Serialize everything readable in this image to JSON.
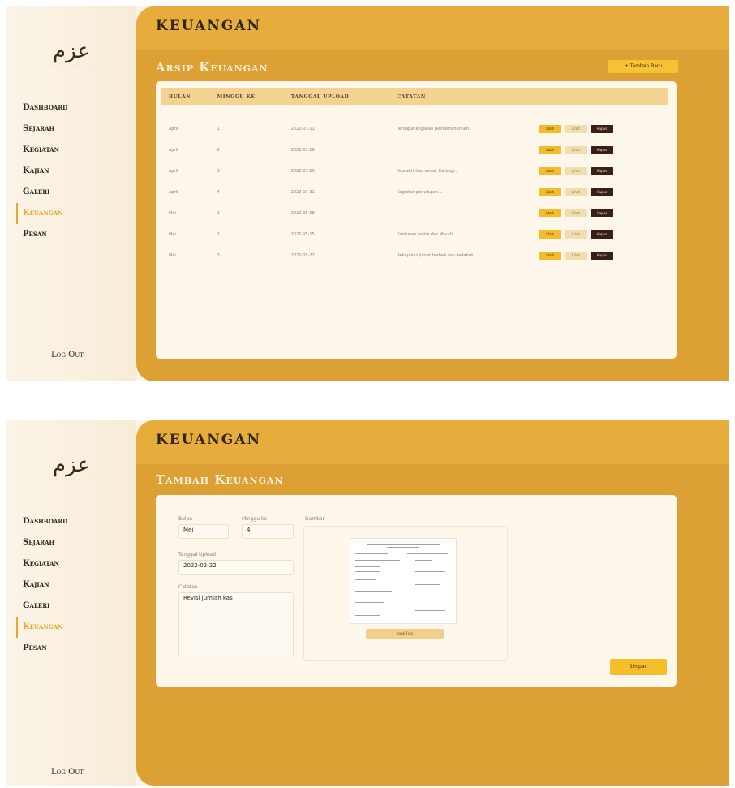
{
  "app": {
    "logo_text": "عزم",
    "nav": [
      "Dashboard",
      "Sejarah",
      "Kegiatan",
      "Kajian",
      "Galeri",
      "Keuangan",
      "Pesan"
    ],
    "active_nav": "Keuangan",
    "logout": "Log Out",
    "header_title": "KEUANGAN"
  },
  "archive": {
    "title": "Arsip Keuangan",
    "add_button": "+ Tambah Baru",
    "columns": [
      "BULAN",
      "MINGGU KE",
      "TANGGAL UPLOAD",
      "CATATAN"
    ],
    "rows": [
      {
        "month": "April",
        "week": "1",
        "date": "2022-03-11",
        "note": "Terdapat kegiatan pembersihan lan.."
      },
      {
        "month": "April",
        "week": "2",
        "date": "2022-03-18",
        "note": ""
      },
      {
        "month": "April",
        "week": "3",
        "date": "2022-03-25",
        "note": "Ada aktivitas sosial. Berbagi..."
      },
      {
        "month": "April",
        "week": "4",
        "date": "2022-03-31",
        "note": "Kegiatan penutupan..."
      },
      {
        "month": "Mei",
        "week": "1",
        "date": "2022-05-08",
        "note": ""
      },
      {
        "month": "Mei",
        "week": "2",
        "date": "2022-05-15",
        "note": "Santunan yatim dan dhuafa..."
      },
      {
        "month": "Mei",
        "week": "3",
        "date": "2022-05-22",
        "note": "Rekap kas jumat berkah dan sedekah..."
      }
    ],
    "actions": [
      "Ubah",
      "Lihat",
      "Hapus"
    ]
  },
  "form": {
    "title": "Tambah Keuangan",
    "month_label": "Bulan",
    "month_value": "Mei",
    "week_label": "Minggu ke",
    "week_value": "4",
    "date_label": "Tanggal Upload",
    "date_value": "2022-02-22",
    "note_label": "Catatan",
    "note_value": "Revisi jumlah kas",
    "image_label": "Gambar",
    "change_image_button": "Ganti Foto",
    "save_button": "Simpan"
  }
}
